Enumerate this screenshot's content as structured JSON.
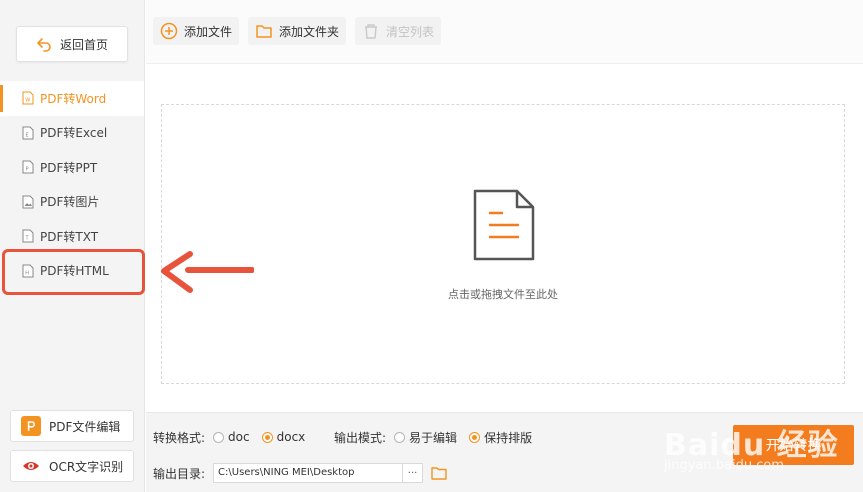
{
  "sidebar": {
    "back_label": "返回首页",
    "items": [
      {
        "label": "PDF转Word",
        "icon": "word-file-icon",
        "active": true
      },
      {
        "label": "PDF转Excel",
        "icon": "excel-file-icon"
      },
      {
        "label": "PDF转PPT",
        "icon": "ppt-file-icon"
      },
      {
        "label": "PDF转图片",
        "icon": "image-file-icon"
      },
      {
        "label": "PDF转TXT",
        "icon": "txt-file-icon"
      },
      {
        "label": "PDF转HTML",
        "icon": "html-file-icon",
        "highlighted": true
      }
    ],
    "tools": [
      {
        "label": "PDF文件编辑",
        "icon": "pdf-edit-icon",
        "color": "#f39422"
      },
      {
        "label": "OCR文字识别",
        "icon": "ocr-eye-icon",
        "color": "#d9362a"
      }
    ]
  },
  "toolbar": {
    "add_file": "添加文件",
    "add_folder": "添加文件夹",
    "clear_list": "清空列表"
  },
  "drop_zone": {
    "hint": "点击或拖拽文件至此处"
  },
  "settings": {
    "format_label": "转换格式:",
    "format_options": [
      "doc",
      "docx"
    ],
    "format_selected": "docx",
    "mode_label": "输出模式:",
    "mode_options": [
      "易于编辑",
      "保持排版"
    ],
    "mode_selected": "保持排版",
    "output_label": "输出目录:",
    "output_path": "C:\\Users\\NING MEI\\Desktop",
    "browse_label": "···",
    "start_label": "开始转换"
  },
  "watermark": {
    "text": "Baidu 经验",
    "sub": "jingyan.baidu.com"
  },
  "colors": {
    "accent": "#f39422",
    "highlight": "#e8533c",
    "start_button": "#f37c1f"
  }
}
